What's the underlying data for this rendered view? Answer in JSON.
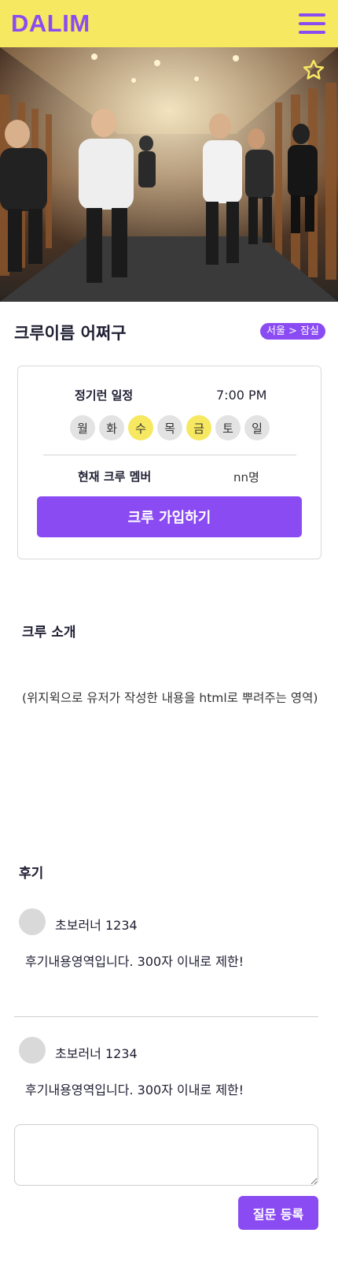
{
  "header": {
    "logo": "DALIM",
    "menu_icon": "hamburger-menu-icon"
  },
  "hero": {
    "favorite_icon": "star-outline-icon",
    "accent": "#f7e862"
  },
  "crew": {
    "name": "크루이름 어쩌구",
    "region": "서울 > 잠실"
  },
  "schedule": {
    "label": "정기런 일정",
    "time": "7:00 PM",
    "days": [
      {
        "label": "월",
        "active": false
      },
      {
        "label": "화",
        "active": false
      },
      {
        "label": "수",
        "active": true
      },
      {
        "label": "목",
        "active": false
      },
      {
        "label": "금",
        "active": true
      },
      {
        "label": "토",
        "active": false
      },
      {
        "label": "일",
        "active": false
      }
    ]
  },
  "members": {
    "label": "현재 크루 멤버",
    "count": "nn명"
  },
  "join_button": "크루 가입하기",
  "intro": {
    "heading": "크루 소개",
    "body": "(위지윅으로 유저가 작성한 내용을 html로 뿌려주는 영역)"
  },
  "reviews": {
    "heading": "후기",
    "items": [
      {
        "author": "초보러너 1234",
        "text": "후기내용영역입니다. 300자 이내로 제한!"
      },
      {
        "author": "초보러너 1234",
        "text": "후기내용영역입니다. 300자 이내로 제한!"
      }
    ]
  },
  "question": {
    "input_value": "",
    "submit_label": "질문 등록"
  },
  "colors": {
    "brand": "#8a4cf2",
    "header_bg": "#f7e862",
    "day_active": "#f7e862",
    "day_inactive": "#e3e3e3"
  }
}
